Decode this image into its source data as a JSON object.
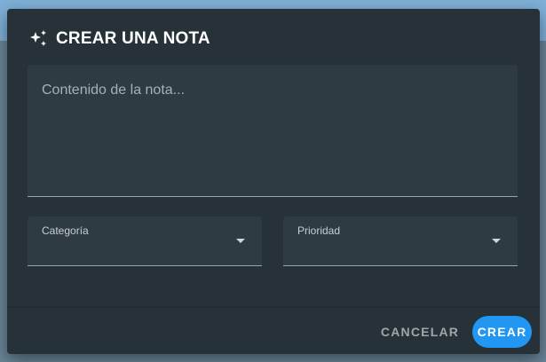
{
  "dialog": {
    "title": "CREAR UNA NOTA",
    "title_icon": "sparkle-icon",
    "content": {
      "placeholder": "Contenido de la nota...",
      "value": ""
    },
    "category": {
      "label": "Categoría",
      "value": "",
      "icon": "chevron-down-icon"
    },
    "priority": {
      "label": "Prioridad",
      "value": "",
      "icon": "chevron-down-icon"
    },
    "actions": {
      "cancel_label": "CANCELAR",
      "create_label": "CREAR"
    }
  },
  "colors": {
    "dialog_bg": "#263238",
    "field_bg": "#2f3b42",
    "accent": "#2196f3",
    "text_primary": "#ffffff",
    "text_muted": "#9ea6ab"
  }
}
